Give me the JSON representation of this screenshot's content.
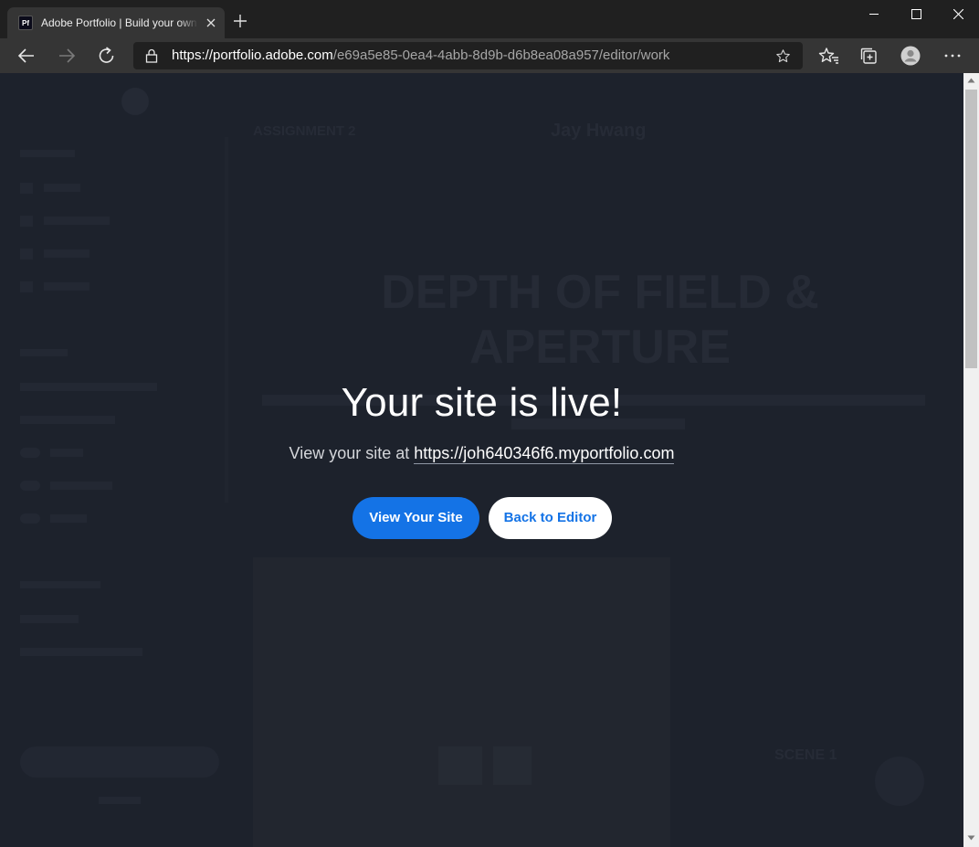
{
  "browser": {
    "tab_favicon": "Pf",
    "tab_title": "Adobe Portfolio | Build your own personalized website",
    "url_host": "https://portfolio.adobe.com",
    "url_path": "/e69a5e85-0ea4-4abb-8d9b-d6b8ea08a957/editor/work"
  },
  "page": {
    "header_left": "ASSIGNMENT 2",
    "header_center": "Jay Hwang",
    "hero_line1": "DEPTH OF FIELD &",
    "hero_line2": "APERTURE",
    "scene_label": "SCENE 1"
  },
  "modal": {
    "title": "Your site is live!",
    "subtitle_prefix": "View your site at",
    "site_url": "https://joh640346f6.myportfolio.com",
    "primary_button": "View Your Site",
    "secondary_button": "Back to Editor"
  },
  "colors": {
    "overlay": "#1d222c",
    "accent": "#1473e6"
  }
}
